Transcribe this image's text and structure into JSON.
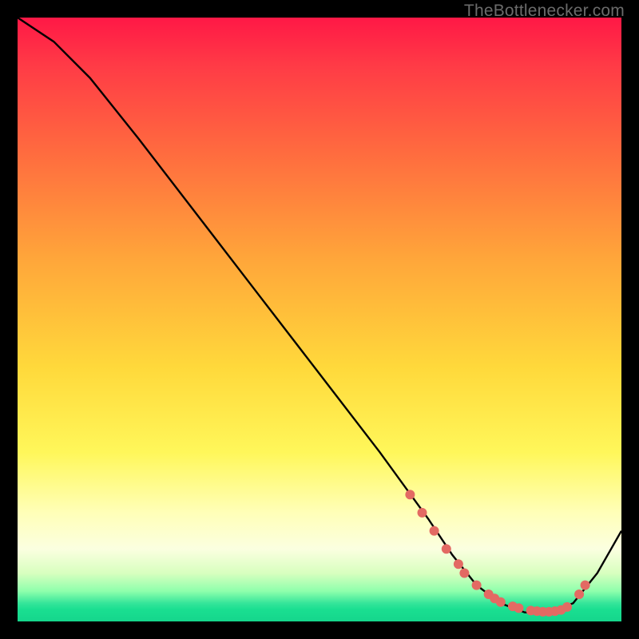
{
  "attribution": "TheBottlenecker.com",
  "chart_data": {
    "type": "line",
    "title": "",
    "xlabel": "",
    "ylabel": "",
    "xlim": [
      0,
      100
    ],
    "ylim": [
      0,
      100
    ],
    "series": [
      {
        "name": "curve",
        "x": [
          0,
          6,
          12,
          20,
          30,
          40,
          50,
          60,
          68,
          72,
          76,
          80,
          84,
          88,
          92,
          96,
          100
        ],
        "y": [
          100,
          96,
          90,
          80,
          67,
          54,
          41,
          28,
          17,
          11,
          6,
          3,
          1.5,
          1.5,
          3,
          8,
          15
        ]
      }
    ],
    "markers": {
      "name": "highlight-points",
      "color": "#e36a63",
      "x": [
        65,
        67,
        69,
        71,
        73,
        74,
        76,
        78,
        79,
        80,
        82,
        83,
        85,
        86,
        87,
        88,
        89,
        90,
        91,
        93,
        94
      ],
      "y": [
        21,
        18,
        15,
        12,
        9.5,
        8,
        6,
        4.5,
        3.8,
        3.2,
        2.5,
        2.2,
        1.8,
        1.7,
        1.6,
        1.6,
        1.7,
        1.9,
        2.4,
        4.5,
        6
      ]
    }
  }
}
